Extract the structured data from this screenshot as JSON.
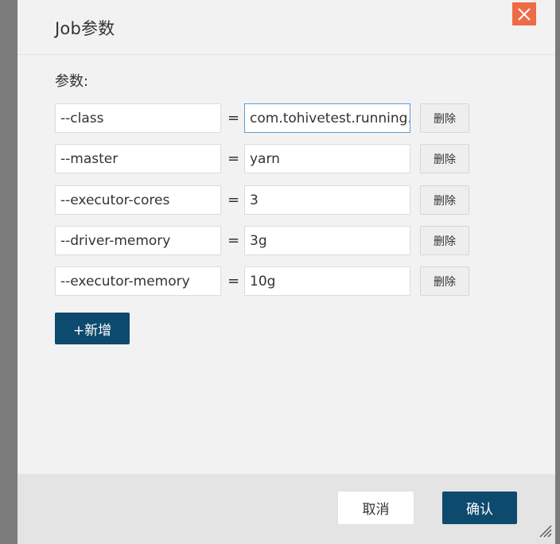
{
  "dialog": {
    "title": "Job参数",
    "close_icon": "close-icon",
    "section_label": "参数:",
    "params": [
      {
        "key": "--class",
        "value": "com.tohivetest.running.",
        "delete_label": "删除"
      },
      {
        "key": "--master",
        "value": "yarn",
        "delete_label": "删除"
      },
      {
        "key": "--executor-cores",
        "value": "3",
        "delete_label": "删除"
      },
      {
        "key": "--driver-memory",
        "value": "3g",
        "delete_label": "删除"
      },
      {
        "key": "--executor-memory",
        "value": "10g",
        "delete_label": "删除"
      }
    ],
    "equals_sign": "=",
    "add_label": "+新增",
    "cancel_label": "取消",
    "confirm_label": "确认"
  },
  "colors": {
    "primary": "#0c4a6e",
    "close_bg": "#ef6b46",
    "dialog_bg": "#f2f2f2",
    "footer_bg": "#e4e4e4"
  }
}
